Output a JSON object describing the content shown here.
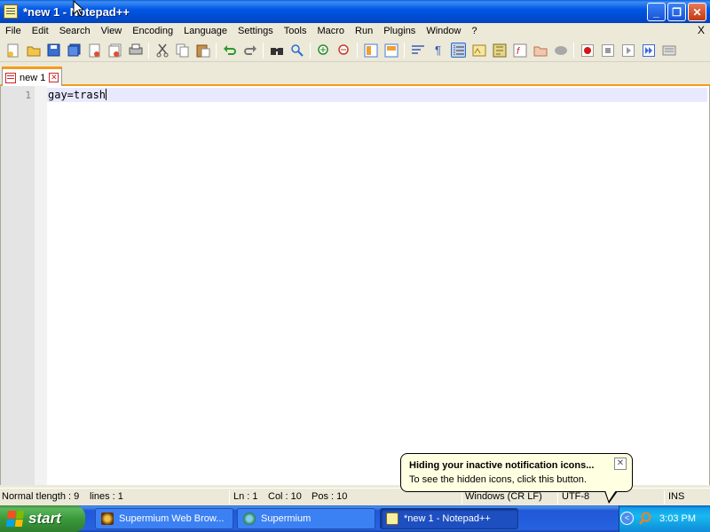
{
  "window": {
    "title": "*new 1 - Notepad++",
    "controls": {
      "minimize": "_",
      "maximize": "❐",
      "close": "✕"
    }
  },
  "menubar": {
    "items": [
      "File",
      "Edit",
      "Search",
      "View",
      "Encoding",
      "Language",
      "Settings",
      "Tools",
      "Macro",
      "Run",
      "Plugins",
      "Window",
      "?"
    ],
    "close_label": "X"
  },
  "toolbar": {
    "icons": [
      "new-file-icon",
      "open-file-icon",
      "save-icon",
      "save-all-icon",
      "close-icon",
      "close-all-icon",
      "print-icon",
      "cut-icon",
      "copy-icon",
      "paste-icon",
      "undo-icon",
      "redo-icon",
      "find-icon",
      "replace-icon",
      "zoom-in-icon",
      "zoom-out-icon",
      "sync-vertical-icon",
      "sync-horizontal-icon",
      "word-wrap-icon",
      "show-all-chars-icon",
      "indent-guide-icon",
      "user-language-icon",
      "doc-map-icon",
      "function-list-icon",
      "folder-workspace-icon",
      "monitoring-icon",
      "record-macro-icon",
      "stop-macro-icon",
      "play-macro-icon",
      "run-macro-multiple-icon",
      "save-macro-icon"
    ]
  },
  "tabs": [
    {
      "label": "new 1",
      "active": true
    }
  ],
  "editor": {
    "lines": [
      {
        "number": "1",
        "text": "gay=trash"
      }
    ]
  },
  "statusbar": {
    "file_type": "Normal t",
    "length": "length : 9",
    "lines": "lines : 1",
    "ln": "Ln : 1",
    "col": "Col : 10",
    "pos": "Pos : 10",
    "eol": "Windows (CR LF)",
    "encoding": "UTF-8",
    "mode": "INS"
  },
  "taskbar": {
    "start_label": "start",
    "buttons": [
      {
        "label": "Supermium Web Brow...",
        "active": false
      },
      {
        "label": "Supermium",
        "active": false
      },
      {
        "label": "*new 1 - Notepad++",
        "active": true
      }
    ],
    "clock": "3:03 PM"
  },
  "balloon": {
    "title": "Hiding your inactive notification icons...",
    "text": "To see the hidden icons, click this button."
  },
  "colors": {
    "titlebar_blue": "#0058e6",
    "tab_accent": "#f59c1a",
    "current_line": "#e8e8ff",
    "gutter": "#e4e4e4",
    "balloon_bg": "#ffffe1",
    "start_green": "#3a9a3a"
  }
}
